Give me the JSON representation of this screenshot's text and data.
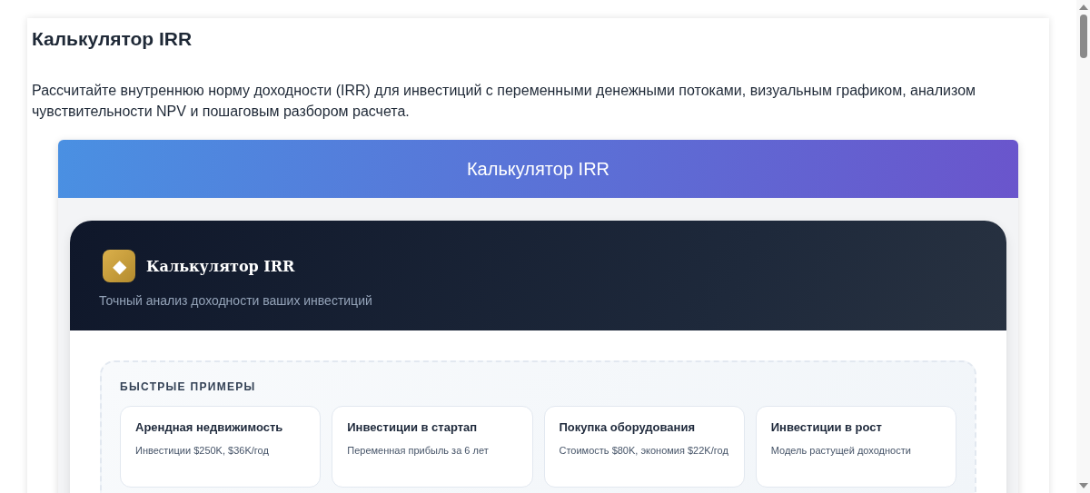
{
  "page": {
    "title": "Калькулятор IRR",
    "description": "Рассчитайте внутреннюю норму доходности (IRR) для инвестиций с переменными денежными потоками, визуальным графиком, анализом чувствительности NPV и пошаговым разбором расчета."
  },
  "widget": {
    "banner_title": "Калькулятор IRR",
    "brand_icon": "◆",
    "brand_title": "Калькулятор IRR",
    "brand_subtitle": "Точный анализ доходности ваших инвестиций"
  },
  "quick_examples": {
    "heading": "БЫСТРЫЕ ПРИМЕРЫ",
    "items": [
      {
        "title": "Арендная недвижимость",
        "description": "Инвестиции $250K, $36K/год"
      },
      {
        "title": "Инвестиции в стартап",
        "description": "Переменная прибыль за 6 лет"
      },
      {
        "title": "Покупка оборудования",
        "description": "Стоимость $80K, экономия $22K/год"
      },
      {
        "title": "Инвестиции в рост",
        "description": "Модель растущей доходности"
      }
    ]
  }
}
